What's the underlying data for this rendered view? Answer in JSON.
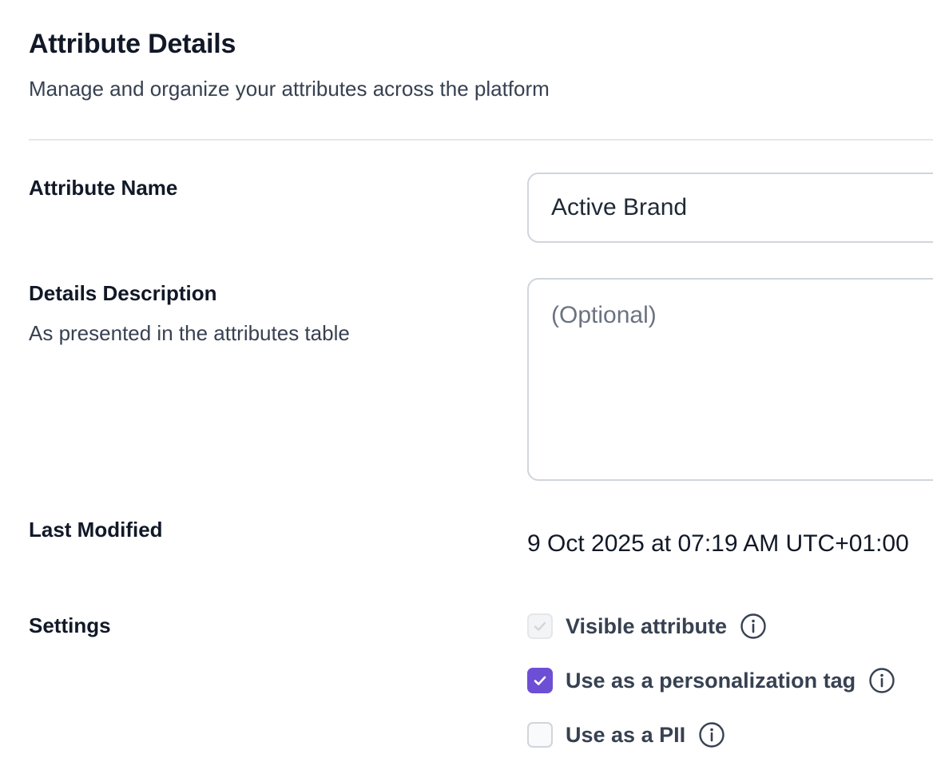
{
  "header": {
    "title": "Attribute Details",
    "subtitle": "Manage and organize your attributes across the platform"
  },
  "form": {
    "name_label": "Attribute Name",
    "name_value": "Active Brand",
    "description_label": "Details Description",
    "description_helper": "As presented in the attributes table",
    "description_value": "",
    "description_placeholder": "(Optional)",
    "last_modified_label": "Last Modified",
    "last_modified_value": "9 Oct 2025 at 07:19 AM UTC+01:00",
    "settings_label": "Settings"
  },
  "settings": [
    {
      "label": "Visible attribute",
      "checked": true,
      "disabled": true,
      "icon": "info-icon"
    },
    {
      "label": "Use as a personalization tag",
      "checked": true,
      "disabled": false,
      "icon": "info-icon"
    },
    {
      "label": "Use as a PII",
      "checked": false,
      "disabled": false,
      "icon": "info-icon"
    }
  ],
  "colors": {
    "accent": "#6d4fd6",
    "border": "#d1d5db",
    "text": "#111827"
  }
}
